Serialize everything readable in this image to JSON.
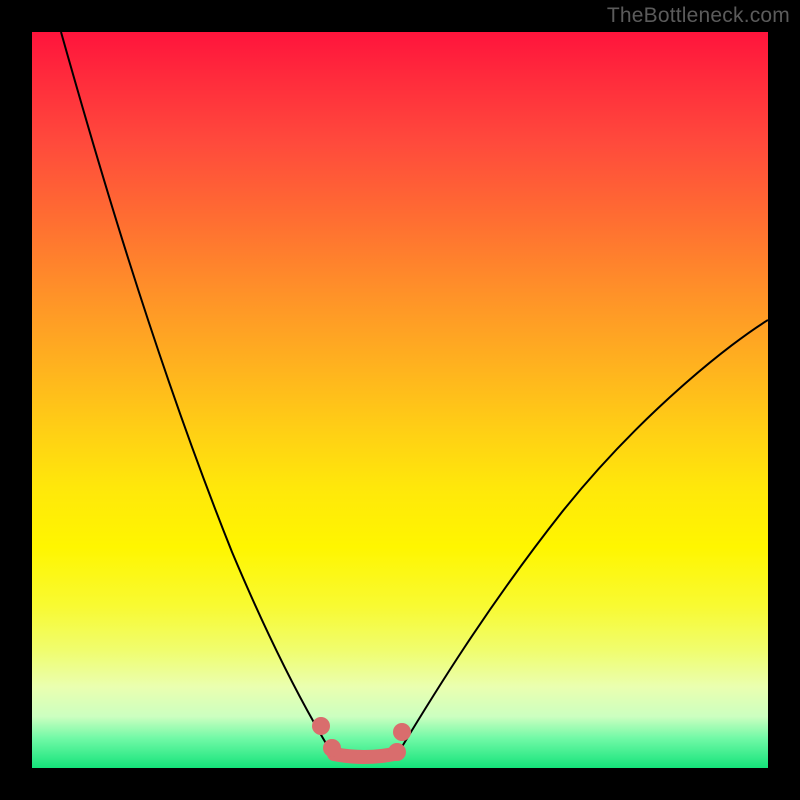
{
  "watermark": "TheBottleneck.com",
  "chart_data": {
    "type": "line",
    "title": "",
    "xlabel": "",
    "ylabel": "",
    "xlim": [
      0,
      100
    ],
    "ylim": [
      0,
      100
    ],
    "series": [
      {
        "name": "left-curve",
        "x": [
          4,
          8,
          12,
          16,
          20,
          24,
          28,
          32,
          34,
          36,
          38,
          40
        ],
        "y": [
          100,
          85,
          70,
          56,
          44,
          33,
          23,
          14,
          10,
          7,
          4,
          2
        ]
      },
      {
        "name": "right-curve",
        "x": [
          50,
          53,
          56,
          60,
          66,
          74,
          84,
          96,
          100
        ],
        "y": [
          2,
          4,
          8,
          14,
          22,
          32,
          44,
          56,
          60
        ]
      },
      {
        "name": "valley-floor",
        "x": [
          40,
          42,
          44,
          46,
          48,
          50
        ],
        "y": [
          1.5,
          1,
          1,
          1,
          1,
          1.5
        ]
      }
    ],
    "markers": [
      {
        "name": "dot-left-upper",
        "x": 39,
        "y": 5.5
      },
      {
        "name": "dot-left-lower",
        "x": 40.5,
        "y": 2.5
      },
      {
        "name": "dot-right-upper",
        "x": 50,
        "y": 5
      },
      {
        "name": "dot-right-lower",
        "x": 49.5,
        "y": 2
      }
    ],
    "colors": {
      "curve": "#000000",
      "markers": "#d96d6d",
      "gradient_top": "#ff143c",
      "gradient_bottom": "#14e37a"
    }
  }
}
